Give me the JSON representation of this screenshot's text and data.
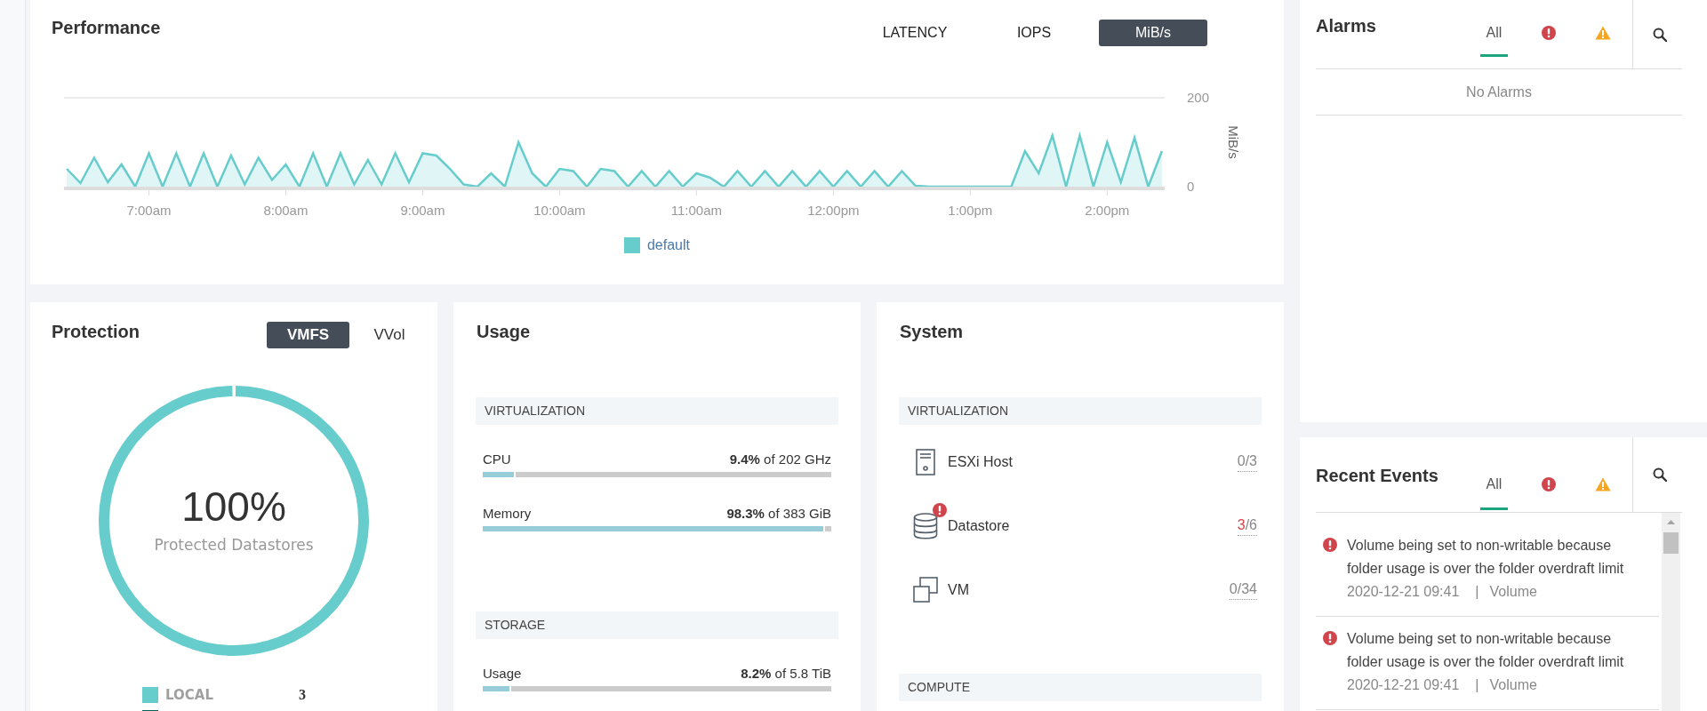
{
  "performance": {
    "title": "Performance",
    "metric_tabs": [
      {
        "label": "LATENCY",
        "selected": false
      },
      {
        "label": "IOPS",
        "selected": false
      },
      {
        "label": "MiB/s",
        "selected": true
      }
    ],
    "chart_data": {
      "type": "area",
      "ylabel": "MiB/s",
      "x": [
        6.4,
        6.5,
        6.6,
        6.7,
        6.8,
        6.9,
        7,
        7.1,
        7.2,
        7.3,
        7.4,
        7.5,
        7.6,
        7.7,
        7.8,
        7.9,
        8,
        8.1,
        8.2,
        8.3,
        8.4,
        8.5,
        8.6,
        8.7,
        8.8,
        8.9,
        9,
        9.1,
        9.2,
        9.3,
        9.4,
        9.5,
        9.6,
        9.7,
        9.8,
        9.9,
        10,
        10.1,
        10.2,
        10.3,
        10.4,
        10.5,
        10.6,
        10.7,
        10.8,
        10.9,
        11,
        11.1,
        11.2,
        11.3,
        11.4,
        11.5,
        11.6,
        11.7,
        11.8,
        11.9,
        12,
        12.1,
        12.2,
        12.3,
        12.4,
        12.5,
        12.6,
        12.7,
        12.8,
        12.9,
        13,
        13.1,
        13.2,
        13.3,
        13.4,
        13.5,
        13.6,
        13.7,
        13.8,
        13.9,
        14,
        14.1,
        14.2,
        14.3,
        14.4
      ],
      "series": [
        {
          "name": "default",
          "color": "#66cccc",
          "values": [
            40,
            8,
            65,
            10,
            50,
            0,
            75,
            0,
            75,
            0,
            75,
            0,
            70,
            5,
            65,
            15,
            50,
            0,
            75,
            0,
            75,
            5,
            60,
            5,
            75,
            10,
            75,
            70,
            40,
            5,
            0,
            30,
            0,
            100,
            30,
            0,
            40,
            35,
            0,
            40,
            35,
            0,
            35,
            0,
            35,
            0,
            30,
            20,
            0,
            35,
            0,
            35,
            0,
            35,
            0,
            35,
            0,
            35,
            0,
            35,
            0,
            35,
            2,
            0,
            0,
            0,
            0,
            0,
            0,
            0,
            80,
            30,
            115,
            0,
            115,
            0,
            100,
            10,
            110,
            0,
            80
          ]
        }
      ],
      "xlim": [
        6.38,
        14.42
      ],
      "ylim": [
        0,
        200
      ],
      "xticks": [
        {
          "value": 7,
          "label": "7:00am"
        },
        {
          "value": 8,
          "label": "8:00am"
        },
        {
          "value": 9,
          "label": "9:00am"
        },
        {
          "value": 10,
          "label": "10:00am"
        },
        {
          "value": 11,
          "label": "11:00am"
        },
        {
          "value": 12,
          "label": "12:00pm"
        },
        {
          "value": 13,
          "label": "1:00pm"
        },
        {
          "value": 14,
          "label": "2:00pm"
        }
      ],
      "yticks": [
        0,
        200
      ]
    }
  },
  "protection": {
    "title": "Protection",
    "tabs": [
      {
        "label": "VMFS",
        "selected": true
      },
      {
        "label": "VVol",
        "selected": false
      }
    ],
    "ring": {
      "level": 1,
      "value": "100%",
      "caption": "Protected Datastores"
    },
    "legend": [
      {
        "label": "LOCAL",
        "count": "3",
        "color": "#66cccc"
      },
      {
        "color": "#0b5f5f"
      }
    ]
  },
  "usage": {
    "title": "Usage",
    "sections": [
      {
        "heading": "VIRTUALIZATION",
        "meters": [
          {
            "name": "CPU",
            "reading": "**9.4%** of 202 GHz",
            "level": 0.094
          },
          {
            "name": "Memory",
            "reading": "**98.3%** of 383 GiB",
            "level": 0.983
          }
        ]
      },
      {
        "heading": "STORAGE",
        "meters": [
          {
            "name": "Usage",
            "reading": "**8.2%** of 5.8 TiB",
            "level": 0.082
          }
        ]
      }
    ]
  },
  "system": {
    "title": "System",
    "sections": [
      {
        "heading": "VIRTUALIZATION",
        "items": [
          {
            "kind": "host",
            "label": "ESXi Host",
            "count": "0",
            "total": "/3",
            "alert": false
          },
          {
            "kind": "datastore",
            "label": "Datastore",
            "count": "3",
            "total": "/6",
            "alert": true
          },
          {
            "kind": "vm",
            "label": "VM",
            "count": "0",
            "total": "/34",
            "alert": false
          }
        ]
      },
      {
        "heading": "COMPUTE"
      }
    ]
  },
  "alarms": {
    "title": "Alarms",
    "filters": [
      {
        "kind": "all",
        "label": "All",
        "selected": true
      },
      {
        "kind": "error",
        "selected": false
      },
      {
        "kind": "warning",
        "selected": false
      }
    ],
    "empty_message": "No Alarms"
  },
  "recent_events": {
    "title": "Recent Events",
    "filters": [
      {
        "kind": "all",
        "label": "All",
        "selected": true
      },
      {
        "kind": "error",
        "selected": false
      },
      {
        "kind": "warning",
        "selected": false
      }
    ],
    "events": [
      {
        "kind": "error",
        "message": "Volume being set to non-writable because folder usage is over the folder overdraft limit",
        "time": "2020-12-21 09:41",
        "separator": "|",
        "source": "Volume"
      },
      {
        "kind": "error",
        "message": "Volume being set to non-writable because folder usage is over the folder overdraft limit",
        "time": "2020-12-21 09:41",
        "separator": "|",
        "source": "Volume"
      }
    ]
  }
}
